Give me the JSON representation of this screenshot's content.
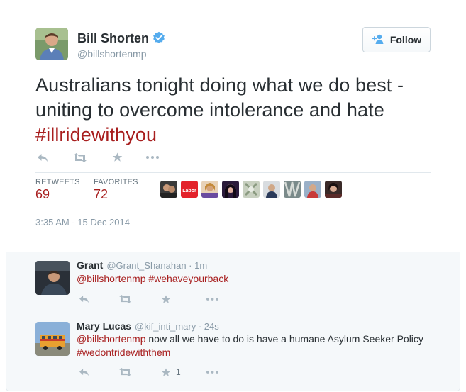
{
  "tweet": {
    "author_name": "Bill Shorten",
    "author_handle": "@billshortenmp",
    "follow_label": "Follow",
    "text_before": "Australians tonight doing what we do best - uniting to overcome intolerance and hate ",
    "hashtag": "#illridewithyou",
    "retweets_label": "RETWEETS",
    "retweets_count": "69",
    "favorites_label": "FAVORITES",
    "favorites_count": "72",
    "timestamp": "3:35 AM - 15 Dec 2014",
    "label_logo_text": "Labor"
  },
  "replies": [
    {
      "name": "Grant",
      "handle_time": "@Grant_Shanahan · 1m",
      "mention": "@billshortenmp",
      "text": "",
      "hashtag": "#wehaveyourback",
      "fav_count": ""
    },
    {
      "name": "Mary Lucas",
      "handle_time": "@kif_inti_mary · 24s",
      "mention": "@billshortenmp",
      "text": "now all we have to do is have a humane Asylum Seeker Policy",
      "hashtag": "#wedontridewiththem",
      "fav_count": "1"
    }
  ],
  "colors": {
    "link": "#a81f1f",
    "verified": "#55acee",
    "icon": "#aab8c2"
  },
  "icons": [
    "verified-icon",
    "follow-person-icon",
    "reply-icon",
    "retweet-icon",
    "favorite-icon",
    "more-icon"
  ]
}
